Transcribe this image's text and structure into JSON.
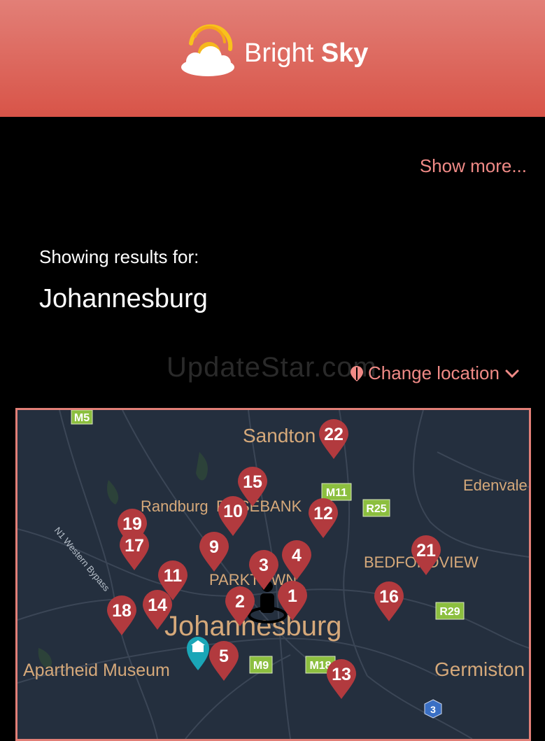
{
  "app": {
    "name_regular": "Bright ",
    "name_bold": "Sky"
  },
  "links": {
    "show_more": "Show more...",
    "change_location": "Change location"
  },
  "results": {
    "label": "Showing results for:",
    "city": "Johannesburg"
  },
  "watermark": "UpdateStar.com",
  "map": {
    "labels": {
      "sandton": "Sandton",
      "edenvale": "Edenvale",
      "randburg": "Randburg",
      "rosebank": "ROSEBANK",
      "bedfordview": "BEDFORDVIEW",
      "parktown": "PARKTOWN",
      "johannesburg": "Johannesburg",
      "apartheid_museum": "Apartheid Museum",
      "germiston": "Germiston",
      "bypass": "N1 Western Bypass"
    },
    "roads": {
      "m5": "M5",
      "m11": "M11",
      "r25": "R25",
      "r29": "R29",
      "m9": "M9",
      "m18": "M18",
      "r3": "3"
    },
    "markers": [
      "22",
      "15",
      "10",
      "12",
      "19",
      "17",
      "9",
      "4",
      "3",
      "21",
      "11",
      "16",
      "1",
      "2",
      "18",
      "14",
      "5",
      "13"
    ]
  }
}
